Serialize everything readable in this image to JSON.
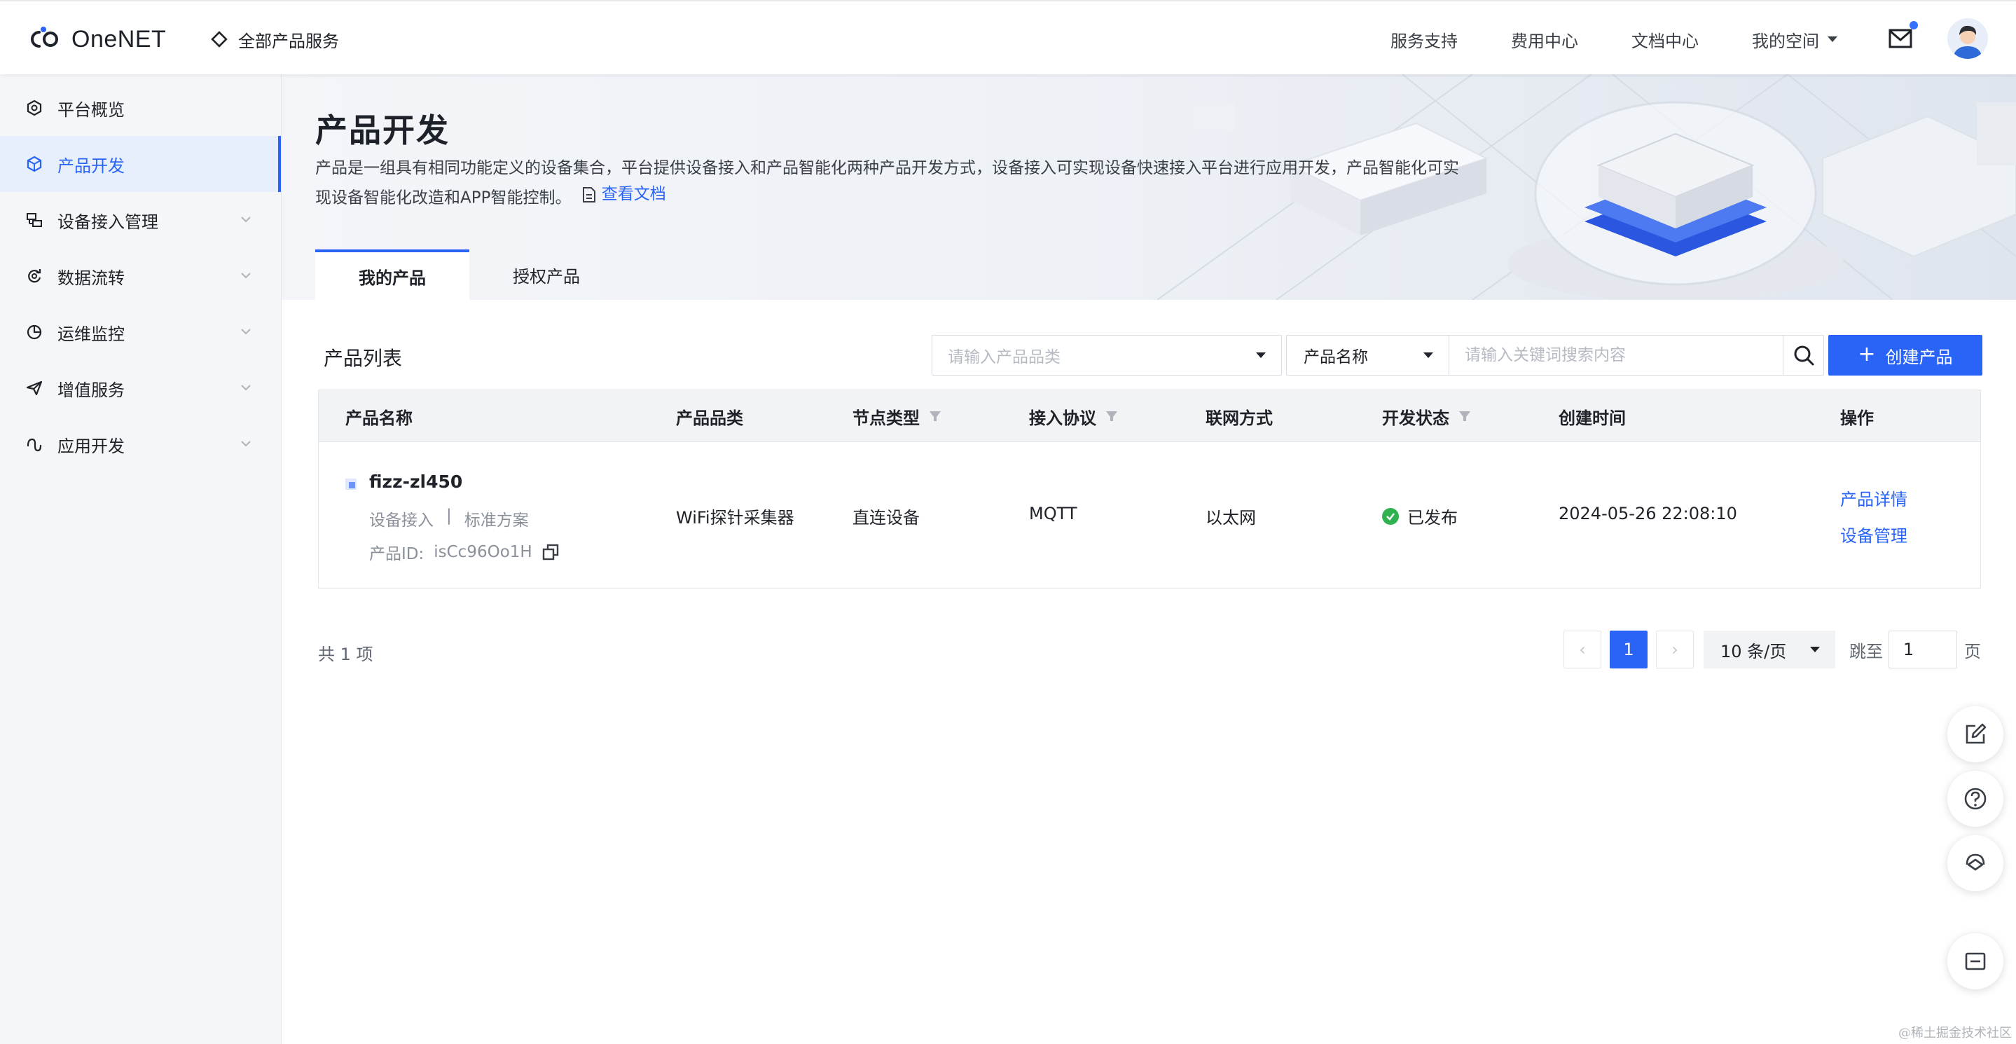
{
  "header": {
    "logo_text": "OneNET",
    "all_products": "全部产品服务",
    "links": [
      "服务支持",
      "费用中心",
      "文档中心"
    ],
    "my_space": "我的空间"
  },
  "sidebar": {
    "items": [
      {
        "label": "平台概览"
      },
      {
        "label": "产品开发"
      },
      {
        "label": "设备接入管理"
      },
      {
        "label": "数据流转"
      },
      {
        "label": "运维监控"
      },
      {
        "label": "增值服务"
      },
      {
        "label": "应用开发"
      }
    ]
  },
  "banner": {
    "title": "产品开发",
    "description": "产品是一组具有相同功能定义的设备集合，平台提供设备接入和产品智能化两种产品开发方式，设备接入可实现设备快速接入平台进行应用开发，产品智能化可实现设备智能化改造和APP智能控制。",
    "doc_link": "查看文档"
  },
  "tabs": [
    "我的产品",
    "授权产品"
  ],
  "list": {
    "title": "产品列表",
    "category_placeholder": "请输入产品品类",
    "search_field": "产品名称",
    "search_placeholder": "请输入关键词搜索内容",
    "create_button": "创建产品"
  },
  "table": {
    "columns": [
      "产品名称",
      "产品品类",
      "节点类型",
      "接入协议",
      "联网方式",
      "开发状态",
      "创建时间",
      "操作"
    ],
    "rows": [
      {
        "name": "fizz-zl450",
        "access_type": "设备接入",
        "separator": "|",
        "scheme": "标准方案",
        "id_label": "产品ID:",
        "id": "isCc96Oo1H",
        "category": "WiFi探针采集器",
        "node_type": "直连设备",
        "protocol": "MQTT",
        "network": "以太网",
        "status": "已发布",
        "created": "2024-05-26 22:08:10",
        "actions": [
          "产品详情",
          "设备管理"
        ]
      }
    ]
  },
  "footer": {
    "total": "共 1 项",
    "prev": "‹",
    "current_page": "1",
    "next": "›",
    "page_size": "10 条/页",
    "jump_label": "跳至",
    "jump_value": "1",
    "page_suffix": "页"
  },
  "watermark": "@稀土掘金技术社区",
  "colors": {
    "accent": "#2a64f6",
    "status_ok": "#2fb24f"
  }
}
